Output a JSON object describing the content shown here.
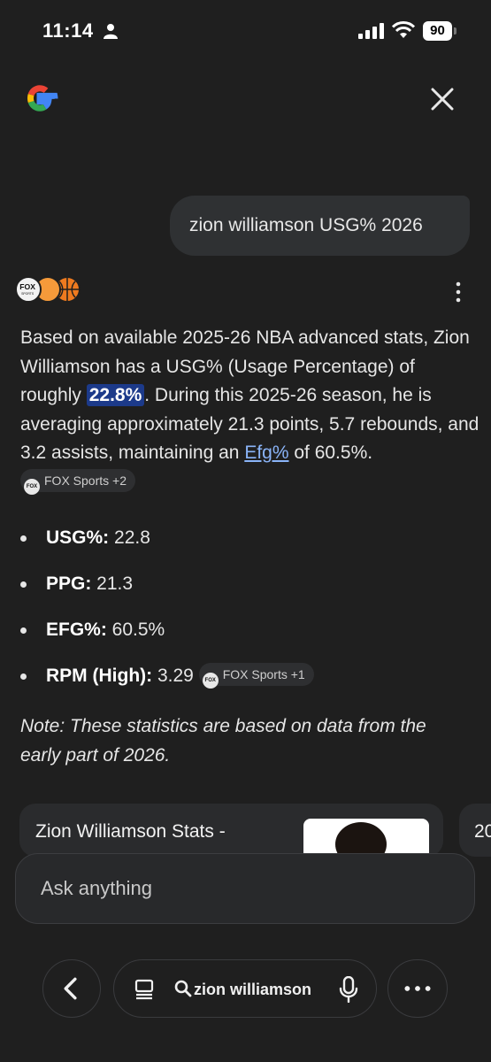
{
  "status_bar": {
    "time": "11:14",
    "battery": "90"
  },
  "query": {
    "text": "zion williamson USG% 2026"
  },
  "answer": {
    "sources": [
      "FOX",
      "SPORTS"
    ],
    "p1": "Based on available 2025-26 NBA advanced stats, Zion Williamson has a USG% (Usage Percentage) of roughly ",
    "highlight": "22.8%",
    "p2": ". During this 2025-26 season, he is averaging approximately 21.3 points, 5.7 rebounds, and 3.2 assists, maintaining an ",
    "link": "Efg%",
    "p3": " of 60.5%.",
    "chip1": "FOX Sports +2",
    "bullets": [
      {
        "label": "USG%:",
        "value": " 22.8"
      },
      {
        "label": "PPG:",
        "value": " 21.3"
      },
      {
        "label": "EFG%:",
        "value": " 60.5%"
      },
      {
        "label": "RPM (High):",
        "value": " 3.29"
      }
    ],
    "chip2": "FOX Sports +1",
    "note": "Note: These statistics are based on data from the early part of 2026."
  },
  "cards": [
    {
      "title": "Zion Williamson Stats -"
    },
    {
      "title": "20"
    }
  ],
  "ask": {
    "placeholder": "Ask anything"
  },
  "bottom_nav": {
    "search_text": "zion williamson"
  },
  "colors": {
    "background": "#1f1f1f",
    "highlight": "#1c3a8a",
    "link": "#8ab4f8"
  }
}
